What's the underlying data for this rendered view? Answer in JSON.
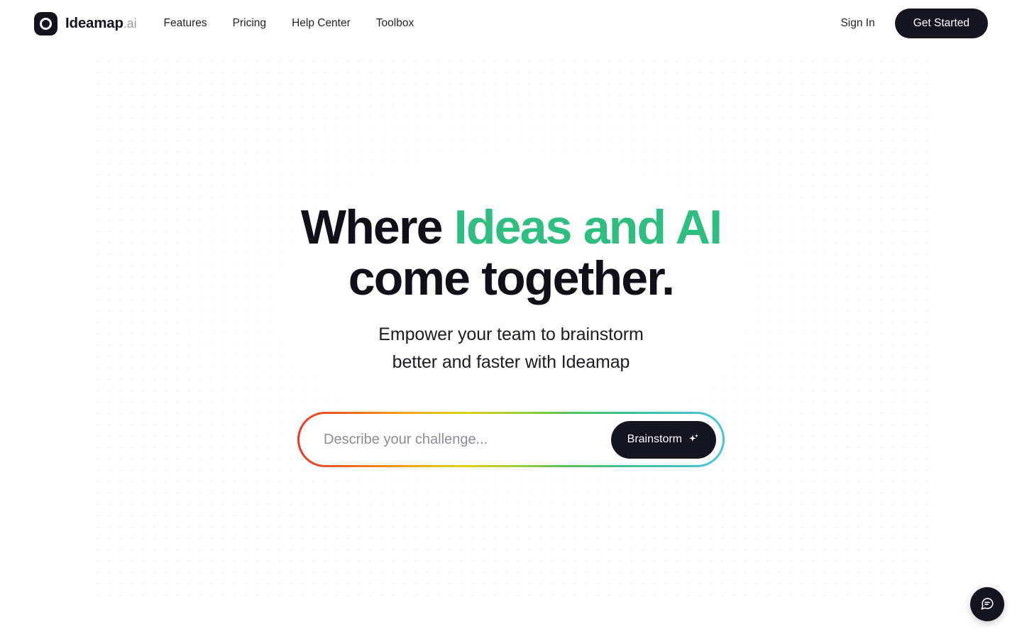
{
  "brand": {
    "name": "Ideamap",
    "tld": ".ai",
    "logo_icon": "ring-logo-icon"
  },
  "nav": {
    "links": [
      {
        "label": "Features"
      },
      {
        "label": "Pricing"
      },
      {
        "label": "Help Center"
      },
      {
        "label": "Toolbox"
      }
    ],
    "sign_in_label": "Sign In",
    "cta_label": "Get Started"
  },
  "hero": {
    "headline_part1": "Where ",
    "headline_accent": "Ideas and AI",
    "headline_part2": "come together.",
    "subheadline_line1": "Empower your team to brainstorm",
    "subheadline_line2": "better and faster with Ideamap"
  },
  "prompt": {
    "placeholder": "Describe your challenge...",
    "value": "",
    "button_label": "Brainstorm",
    "button_icon": "sparkle-icon"
  },
  "chat_widget": {
    "icon": "chat-bubble-icon"
  },
  "colors": {
    "accent_green": "#2fbd80",
    "dark": "#15151f",
    "gradient_start": "#e8392b",
    "gradient_end": "#4cc3dc",
    "placeholder_gray": "#8c8c95"
  }
}
